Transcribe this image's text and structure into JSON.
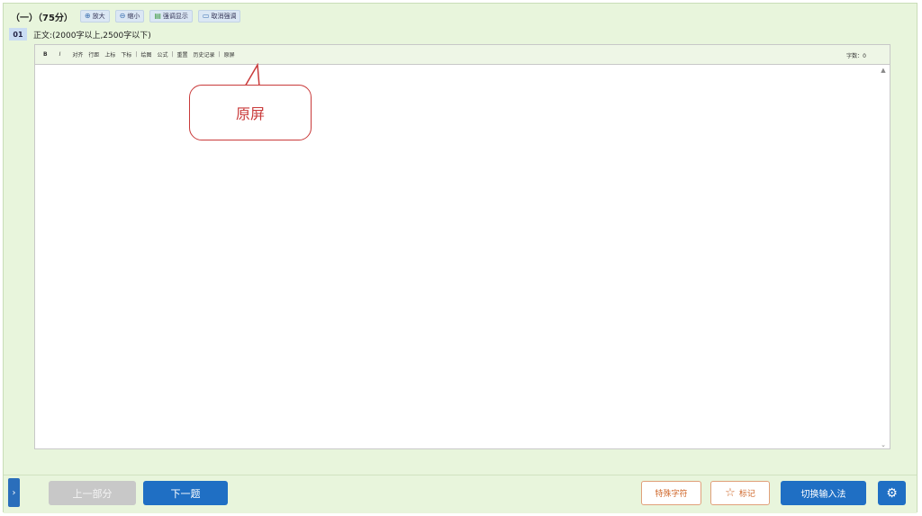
{
  "header": {
    "section_title": "（一）（75分）",
    "buttons": [
      {
        "label": "放大",
        "icon": "zoom-in-icon"
      },
      {
        "label": "缩小",
        "icon": "zoom-out-icon"
      },
      {
        "label": "强调显示",
        "icon": "highlight-icon"
      },
      {
        "label": "取消强调",
        "icon": "unhighlight-icon"
      }
    ]
  },
  "question": {
    "number": "01",
    "label": "正文:(2000字以上,2500字以下)"
  },
  "editor": {
    "toolbar": {
      "bold": "B",
      "italic": "I",
      "align": "对齐",
      "indent": "行距",
      "superscript": "上标",
      "subscript": "下标",
      "image": "绘图",
      "formula": "公式",
      "redo": "重置",
      "history": "历史记录",
      "fullscreen": "原屏",
      "word_count": "字数：0"
    }
  },
  "callout": {
    "text": "原屏"
  },
  "footer": {
    "prev_label": "上一部分",
    "next_label": "下一题",
    "special_chars_label": "特殊字符",
    "mark_label": "标记",
    "switch_ime_label": "切换输入法"
  },
  "colors": {
    "accent": "#1f6fc4",
    "background": "#e8f5dc",
    "callout": "#c93a3a",
    "secondary": "#d06a2e"
  }
}
